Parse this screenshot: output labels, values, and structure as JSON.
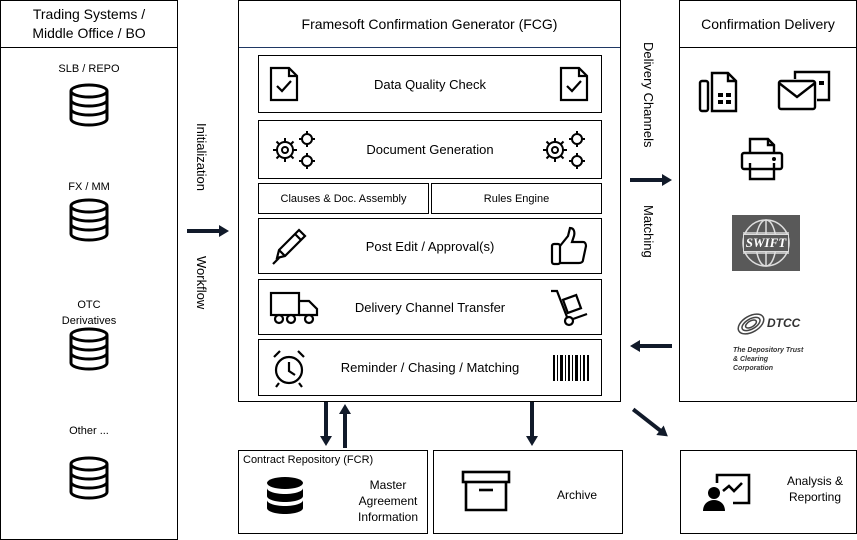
{
  "left_panel": {
    "title": "Trading Systems / Middle Office / BO",
    "sources": [
      {
        "label": "SLB / REPO",
        "icon": "database-icon"
      },
      {
        "label": "FX / MM",
        "icon": "database-icon"
      },
      {
        "label": "OTC Derivatives",
        "icon": "database-icon"
      },
      {
        "label": "Other ...",
        "icon": "database-icon"
      }
    ]
  },
  "left_arrows": {
    "top_label": "Initialization",
    "bottom_label": "Workflow"
  },
  "fcg": {
    "title": "Framesoft Confirmation Generator (FCG)",
    "steps": [
      {
        "label": "Data Quality Check",
        "icon_left": "document-check-icon",
        "icon_right": "document-check-icon"
      },
      {
        "label": "Document Generation",
        "icon_left": "gears-icon",
        "icon_right": "gears-icon"
      },
      {
        "label": "Post Edit / Approval(s)",
        "icon_left": "pen-icon",
        "icon_right": "thumbs-up-icon"
      },
      {
        "label": "Delivery Channel Transfer",
        "icon_left": "truck-icon",
        "icon_right": "hand-truck-icon"
      },
      {
        "label": "Reminder / Chasing / Matching",
        "icon_left": "alarm-clock-icon",
        "icon_right": "barcode-icon"
      }
    ],
    "sub_modules": [
      "Clauses & Doc. Assembly",
      "Rules Engine"
    ]
  },
  "right_arrows": {
    "top_label": "Delivery Channels",
    "bottom_label": "Matching"
  },
  "right_panel": {
    "title": "Confirmation Delivery",
    "channels": [
      "fax-icon",
      "email-icon",
      "printer-icon",
      "swift-logo",
      "dtcc-logo"
    ],
    "swift_text": "SWIFT",
    "dtcc_text": "DTCC",
    "dtcc_subtitle": "The Depository Trust & Clearing Corporation"
  },
  "repository": {
    "title": "Contract Repository (FCR)",
    "label": "Master Agreement Information"
  },
  "archive": {
    "label": "Archive"
  },
  "analysis": {
    "label": "Analysis & Reporting"
  }
}
